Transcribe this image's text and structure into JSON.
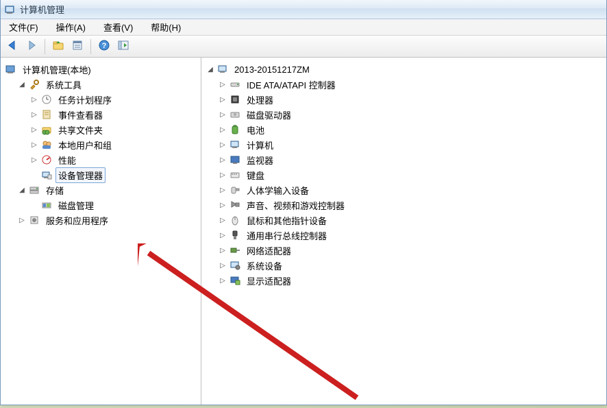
{
  "window": {
    "title": "计算机管理"
  },
  "menu": {
    "file": "文件(F)",
    "action": "操作(A)",
    "view": "查看(V)",
    "help": "帮助(H)"
  },
  "toolbar_icons": {
    "back": "back-icon",
    "forward": "forward-icon",
    "up": "up-icon",
    "properties": "properties-icon",
    "help": "help-icon",
    "show": "show-icon"
  },
  "left_tree": {
    "root": "计算机管理(本地)",
    "system_tools": {
      "label": "系统工具",
      "children": {
        "task_scheduler": "任务计划程序",
        "event_viewer": "事件查看器",
        "shared_folders": "共享文件夹",
        "local_users": "本地用户和组",
        "performance": "性能",
        "device_manager": "设备管理器"
      }
    },
    "storage": {
      "label": "存储",
      "children": {
        "disk_management": "磁盘管理"
      }
    },
    "services_apps": "服务和应用程序"
  },
  "right_tree": {
    "root": "2013-20151217ZM",
    "items": [
      "IDE ATA/ATAPI 控制器",
      "处理器",
      "磁盘驱动器",
      "电池",
      "计算机",
      "监视器",
      "键盘",
      "人体学输入设备",
      "声音、视频和游戏控制器",
      "鼠标和其他指针设备",
      "通用串行总线控制器",
      "网络适配器",
      "系统设备",
      "显示适配器"
    ]
  }
}
